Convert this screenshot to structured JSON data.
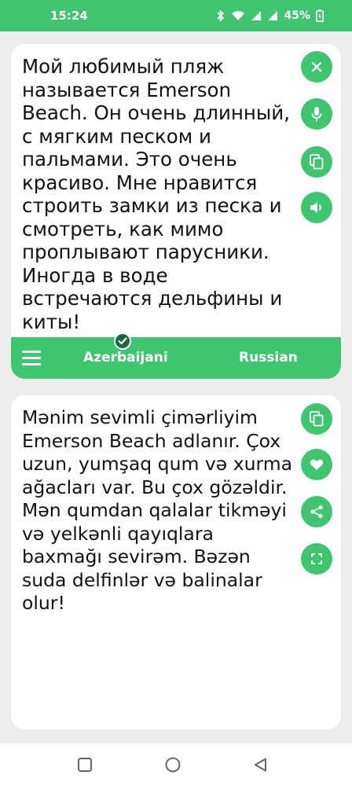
{
  "status_bar": {
    "time": "15:24",
    "battery": "45%",
    "icons": [
      "bluetooth-icon",
      "wifi-icon",
      "signal-icon",
      "signal-icon-2",
      "battery-icon"
    ]
  },
  "source_panel": {
    "text": "Мой любимый пляж называется Emerson Beach. Он очень длинный, с мягким песком и пальмами. Это очень красиво. Мне нравится строить замки из песка и смотреть, как мимо проплывают парусники. Иногда в воде встречаются дельфины и киты!",
    "buttons": [
      "close-icon",
      "microphone-icon",
      "copy-icon",
      "speaker-icon"
    ]
  },
  "language_bar": {
    "source_language": "Azerbaijani",
    "target_language": "Russian"
  },
  "target_panel": {
    "text": "Mənim sevimli çimərliyim Emerson Beach adlanır. Çox uzun, yumşaq qum və xurma ağacları var. Bu çox gözəldir. Mən qumdan qalalar tikməyi və yelkənli qayıqlara baxmağı sevirəm. Bəzən suda delfinlər və balinalar olur!",
    "buttons": [
      "copy-icon",
      "heart-icon",
      "share-icon",
      "fullscreen-icon"
    ]
  },
  "colors": {
    "accent": "#3fc46f",
    "badge": "#1b6b3a",
    "background": "#ededed"
  },
  "nav_bar": {
    "icons": [
      "recents-icon",
      "home-icon",
      "back-icon"
    ]
  }
}
